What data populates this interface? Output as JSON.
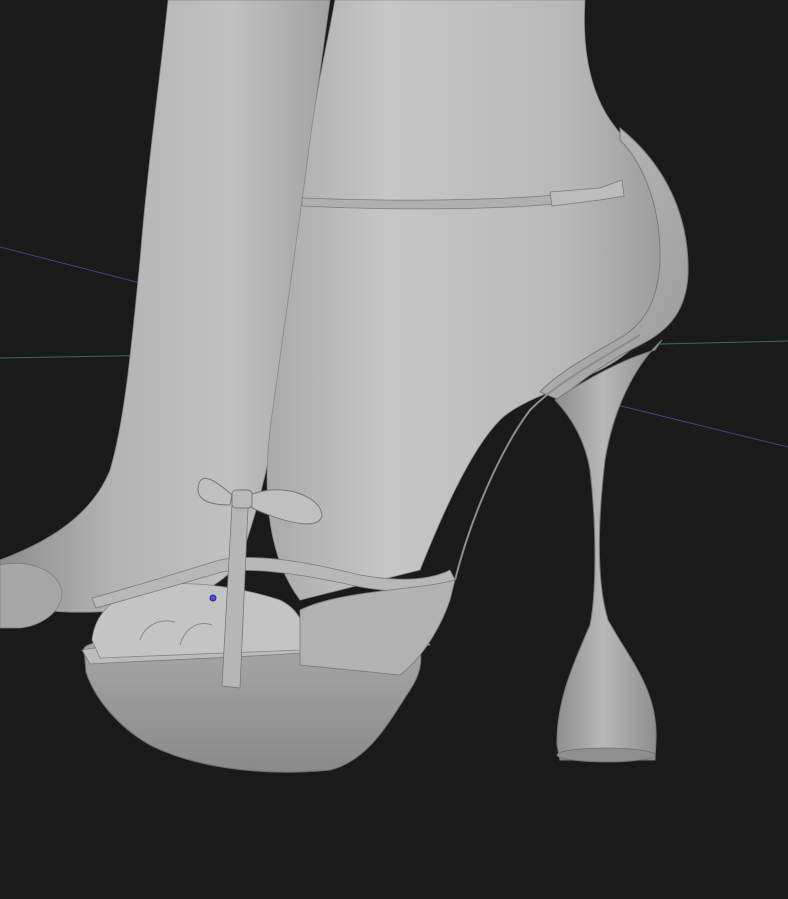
{
  "app": {
    "view": "3D Viewport"
  },
  "viewport": {
    "shading": "solid",
    "background_color": "#1a1a1a",
    "grid_axes": [
      {
        "name": "x-axis",
        "color": "#4a3f8c"
      },
      {
        "name": "y-axis",
        "color": "#3d6b5a"
      }
    ],
    "model_material_color": "#b3b3b3",
    "origin_marker_color": "#4f4fd8"
  }
}
